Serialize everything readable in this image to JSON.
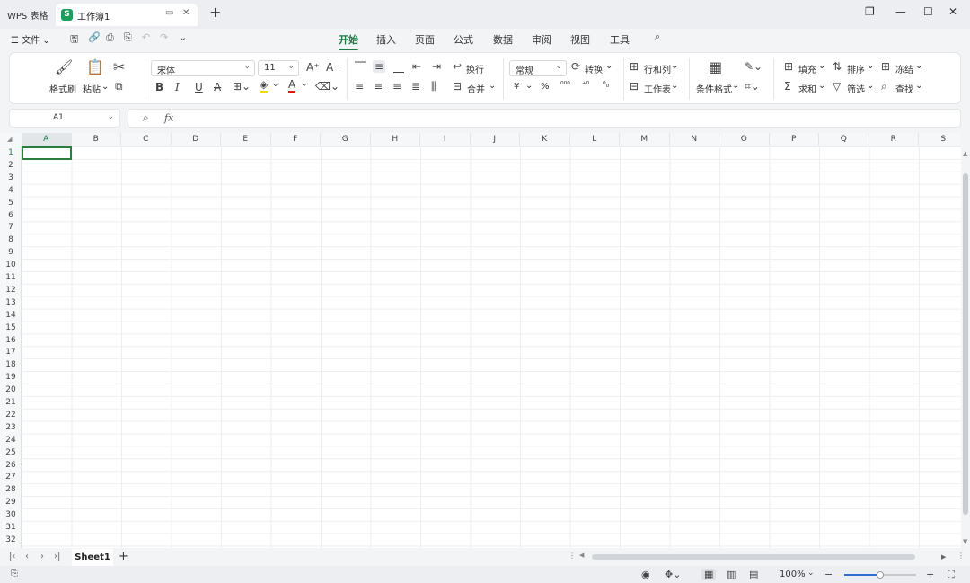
{
  "window": {
    "app_name": "WPS 表格",
    "tab_title": "工作簿1",
    "tab_logo": "S",
    "minimize": "—",
    "maximize": "☐",
    "close": "✕"
  },
  "menu": {
    "file_label": "☰ 文件 ⌄",
    "tabs": [
      "开始",
      "插入",
      "页面",
      "公式",
      "数据",
      "审阅",
      "视图",
      "工具"
    ],
    "active_tab": "开始"
  },
  "ribbon": {
    "format_painter": "格式刷",
    "paste": "粘贴",
    "font_name": "宋体",
    "font_size": "11",
    "wrap": "换行",
    "merge": "合并",
    "number_format": "常规",
    "convert": "转换",
    "currency": "¥",
    "percent": "%",
    "rows_cols": "行和列",
    "worksheet": "工作表",
    "conditional_format": "条件格式",
    "fill": "填充",
    "sort": "排序",
    "freeze": "冻结",
    "sum": "求和",
    "filter": "筛选",
    "find": "查找",
    "bold": "B",
    "italic": "I",
    "underline": "U",
    "strike": "A",
    "font_color": "A",
    "font_color_hex": "#d81e06",
    "highlight_hex": "#f5d800"
  },
  "formula_bar": {
    "cell_ref": "A1",
    "fx": "fx",
    "value": ""
  },
  "grid": {
    "columns": [
      "A",
      "B",
      "C",
      "D",
      "E",
      "F",
      "G",
      "H",
      "I",
      "J",
      "K",
      "L",
      "M",
      "N",
      "O",
      "P",
      "Q",
      "R",
      "S"
    ],
    "rows": [
      "1",
      "2",
      "3",
      "4",
      "5",
      "6",
      "7",
      "8",
      "9",
      "10",
      "11",
      "12",
      "13",
      "14",
      "15",
      "16",
      "17",
      "18",
      "19",
      "20",
      "21",
      "22",
      "23",
      "24",
      "25",
      "26",
      "27",
      "28",
      "29",
      "30",
      "31",
      "32"
    ],
    "selected_column": "A",
    "selected_row": "1"
  },
  "sheets": {
    "tabs": [
      "Sheet1"
    ],
    "active": "Sheet1"
  },
  "status": {
    "zoom": "100%",
    "zoom_fraction": 0.5
  },
  "colors": {
    "accent": "#1e7b48",
    "logo": "#1e9e5b",
    "active_cell_border": "#2a7d3e"
  }
}
